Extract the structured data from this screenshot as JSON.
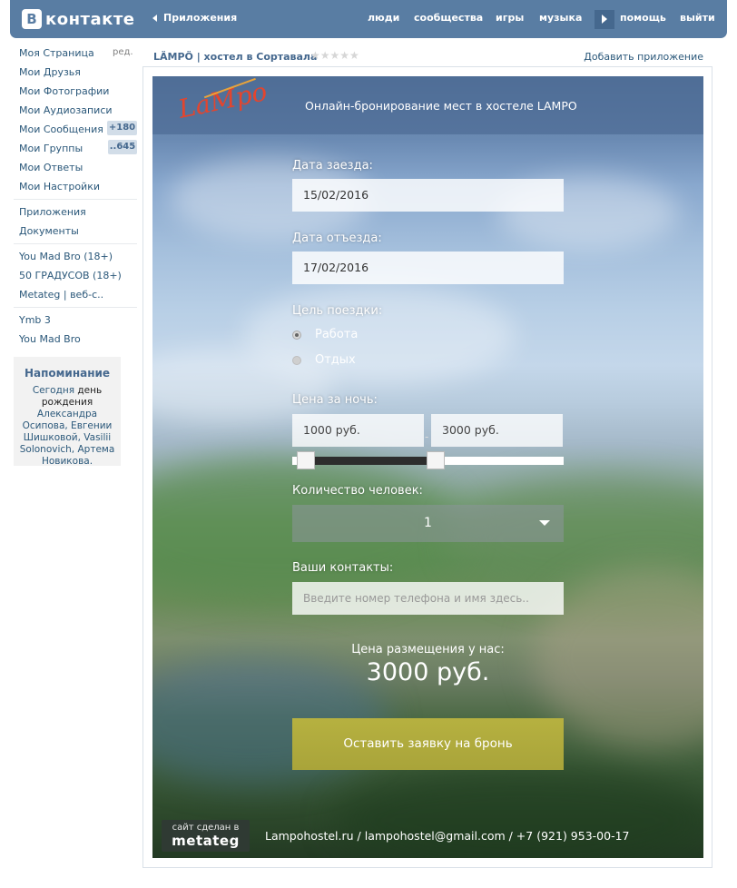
{
  "topbar": {
    "logo_letter": "В",
    "logo_text": "контакте",
    "apps_back": "Приложения",
    "nav": [
      "люди",
      "сообщества",
      "игры",
      "музыка",
      "помощь",
      "выйти"
    ],
    "colors": {
      "bar": "#597da3",
      "link": "#2b587a"
    }
  },
  "sidebar": {
    "edit_label": "ред.",
    "items": [
      "Моя Страница",
      "Мои Друзья",
      "Мои Фотографии",
      "Мои Аудиозаписи",
      "Мои Сообщения",
      "Мои Группы",
      "Мои Ответы",
      "Мои Настройки",
      "Приложения",
      "Документы",
      "You Mad Bro (18+)",
      "50 ГРАДУСОВ (18+)",
      "Metateg | веб-с..",
      "Ymb 3",
      "You Mad Bro"
    ],
    "badges": {
      "messages": "+180",
      "groups": "..645"
    }
  },
  "reminder": {
    "title": "Напоминание",
    "today": "Сегодня",
    "birthday": "день рождения",
    "names": "Александра Осипова, Евгении Шишковой, Vasilii Solonovich, Артема Новикова."
  },
  "app_header": {
    "title": "LÄMPÖ | хостел в Сортавала",
    "stars": "★★★★★",
    "add_app": "Добавить приложение"
  },
  "app": {
    "brand": "LaMpo",
    "headline": "Онлайн-бронирование мест в хостеле LAMPO",
    "checkin_label": "Дата заезда:",
    "checkin_value": "15/02/2016",
    "checkout_label": "Дата отъезда:",
    "checkout_value": "17/02/2016",
    "purpose_label": "Цель поездки:",
    "purpose_options": [
      "Работа",
      "Отдых"
    ],
    "purpose_selected": "Работа",
    "price_label": "Цена за ночь:",
    "price_min": "1000 руб.",
    "price_max": "3000 руб.",
    "price_separator": "-",
    "slider_range": [
      0.05,
      0.53
    ],
    "guests_label": "Количество человек:",
    "guests_value": "1",
    "contacts_label": "Ваши контакты:",
    "contacts_placeholder": "Введите номер телефона и имя здесь..",
    "total_caption": "Цена размещения у нас:",
    "total_value": "3000 руб.",
    "book_button": "Оставить заявку на бронь",
    "made_by_line1": "сайт сделан в",
    "made_by_line2": "metateg",
    "footer_contacts": "Lampohostel.ru / lampohostel@gmail.com / +7 (921) 953-00-17",
    "colors": {
      "button": "#b1ac3d",
      "slider_fill": "#2d2d2d"
    }
  }
}
